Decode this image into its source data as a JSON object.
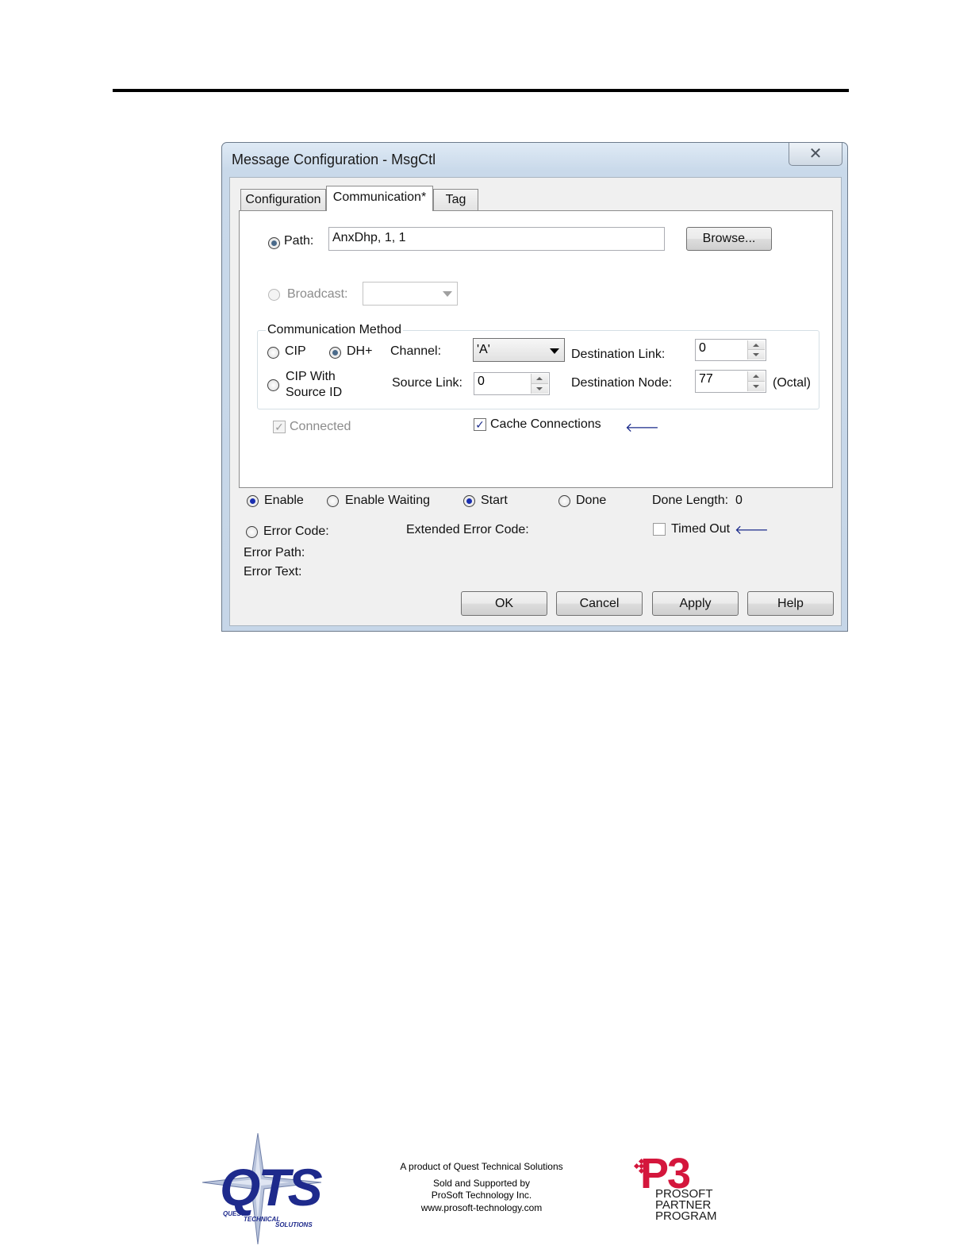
{
  "dialog": {
    "title": "Message Configuration - MsgCtl",
    "close_glyph": "✕",
    "tabs": [
      {
        "label": "Configuration"
      },
      {
        "label": "Communication*"
      },
      {
        "label": "Tag"
      }
    ],
    "path": {
      "label": "Path:",
      "value": "AnxDhp, 1, 1",
      "browse_label": "Browse..."
    },
    "broadcast": {
      "label": "Broadcast:",
      "value": ""
    },
    "communication_method": {
      "legend": "Communication Method",
      "cip_label": "CIP",
      "dhplus_label": "DH+",
      "cip_with_source_id_line1": "CIP With",
      "cip_with_source_id_line2": "Source ID",
      "channel_label": "Channel:",
      "channel_value": "'A'",
      "source_link_label": "Source Link:",
      "source_link_value": "0",
      "destination_link_label": "Destination Link:",
      "destination_link_value": "0",
      "destination_node_label": "Destination Node:",
      "destination_node_value": "77",
      "octal_label": "(Octal)"
    },
    "connected_label": "Connected",
    "cache_connections_label": "Cache Connections",
    "pointer_arrow": "🡐",
    "status": {
      "enable_label": "Enable",
      "enable_waiting_label": "Enable Waiting",
      "start_label": "Start",
      "done_label": "Done",
      "done_length_label": "Done Length:",
      "done_length_value": "0",
      "error_code_label": "Error Code:",
      "extended_error_code_label": "Extended Error Code:",
      "timed_out_label": "Timed Out",
      "error_path_label": "Error Path:",
      "error_text_label": "Error Text:"
    },
    "buttons": {
      "ok": "OK",
      "cancel": "Cancel",
      "apply": "Apply",
      "help": "Help"
    },
    "colors": {
      "radio_selected": "#1a2fb0",
      "arrow": "#1a2a8a",
      "title_bar": "#c9d9ea"
    }
  },
  "footer": {
    "qts_logo_text": "QTS",
    "qts_logo_sub1": "QUEST",
    "qts_logo_sub2": "TECHNICAL",
    "qts_logo_sub3": "SOLUTIONS",
    "line1": "A product of Quest Technical Solutions",
    "line2": "Sold and Supported by",
    "line3": "ProSoft Technology Inc.",
    "line4": "www.prosoft-technology.com",
    "p3_logo_big": "P3",
    "p3_logo_line1": "PROSOFT",
    "p3_logo_line2": "PARTNER",
    "p3_logo_line3": "PROGRAM",
    "colors": {
      "qts_blue": "#1e2a8c",
      "p3_red": "#d4163c"
    }
  }
}
